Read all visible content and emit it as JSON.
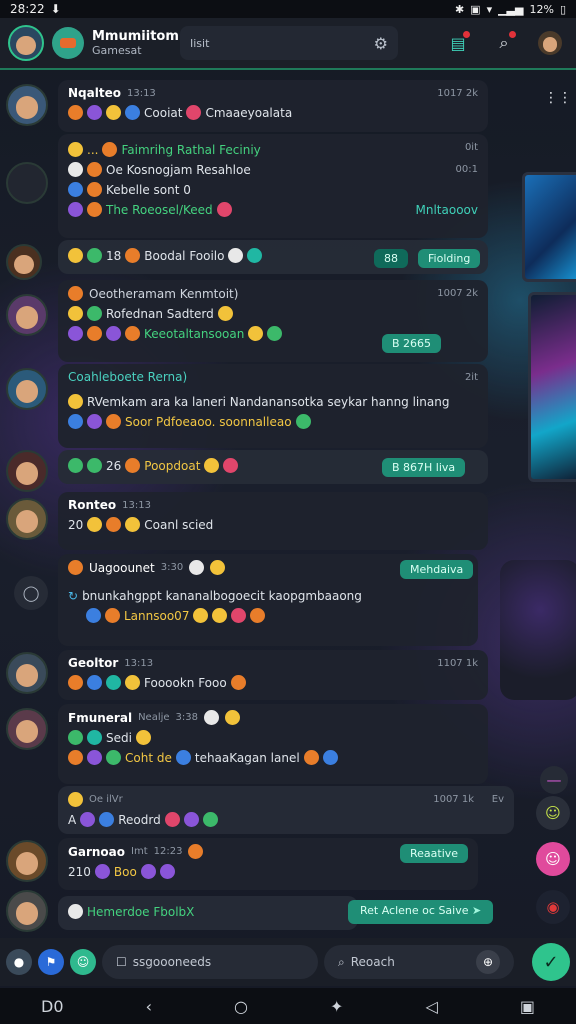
{
  "status_bar": {
    "time": "28:22",
    "battery": "12%"
  },
  "app_bar": {
    "title": "Mmumiitom",
    "subtitle": "Gamesat",
    "search_text": "Iisit"
  },
  "messages": [
    {
      "sender": "Nqalteo",
      "time": "13:13",
      "time_right": "1017 2k",
      "line1": "Cooiat",
      "line1b": "Cmaaeyoalata"
    },
    {
      "header": "Faimrihg Rathal Feciniy",
      "header_time": "0it",
      "line1": "Oe Kosnogjam Resahloe",
      "line1_time": "00:1",
      "line2": "Kebelle sont 0",
      "line3": "The Roeosel/Keed",
      "line3_right": "Mnltaooov",
      "line4_count": "18",
      "line4": "Boodal Fooilo",
      "line4_pill1": "88",
      "line4_pill2": "Fiolding"
    },
    {
      "sender": "Oeotheramam Kenmtoit)",
      "time_right": "1007 2k",
      "line1": "Rofednan Sadterd",
      "line2": "Keeotaltansooan",
      "pill": "B 2665"
    },
    {
      "sender": "Coahleboete Rerna)",
      "time_right": "2it",
      "line1": "RVemkam ara ka laneri Nandanansotka seykar hanng linang",
      "line2": "Soor Pdfoeaoo. soonnalleao"
    },
    {
      "count": "26",
      "line1": "Poopdoat",
      "pill": "B 867H liva"
    },
    {
      "sender": "Ronteo",
      "time": "13:13",
      "count": "20",
      "line1": "Coanl scied"
    },
    {
      "sender": "Uagoounet",
      "time": "3:30",
      "pill": "Mehdaiva",
      "line1": "bnunkahgppt kananalbogoecit kaopgmbaaong",
      "line2": "Lannsoo07"
    },
    {
      "sender": "Geoltor",
      "time": "13:13",
      "time_right": "1107 1k",
      "line1": "Fooookn Fooo"
    },
    {
      "sender": "Fmuneral",
      "time": "3:38",
      "extra": "Nealje",
      "line1": "Sedi",
      "line2a": "Coht de",
      "line2b": "tehaaKagan lanel"
    },
    {
      "sender": "Oe ilVr",
      "time_right": "1007 1k",
      "time_right2": "Ev",
      "prefix": "A",
      "line1": "Reodrd"
    },
    {
      "sender": "Garnoao",
      "time": "12:23",
      "extra": "Imt",
      "count": "210",
      "line1": "Boo",
      "pill": "Reaative"
    },
    {
      "line1": "Hemerdoe FbolbX",
      "pill": "Ret Aclene oc Saive"
    }
  ],
  "composer": {
    "field1_placeholder": "ssgoooneeds",
    "field2_placeholder": "Reoach"
  },
  "colors": {
    "accent": "#2fc48d",
    "bubble": "#1f232d",
    "pill": "#1f8e76"
  },
  "icons": [
    "back-icon",
    "home-icon",
    "recents-icon",
    "send-icon",
    "search-icon",
    "settings-icon"
  ]
}
